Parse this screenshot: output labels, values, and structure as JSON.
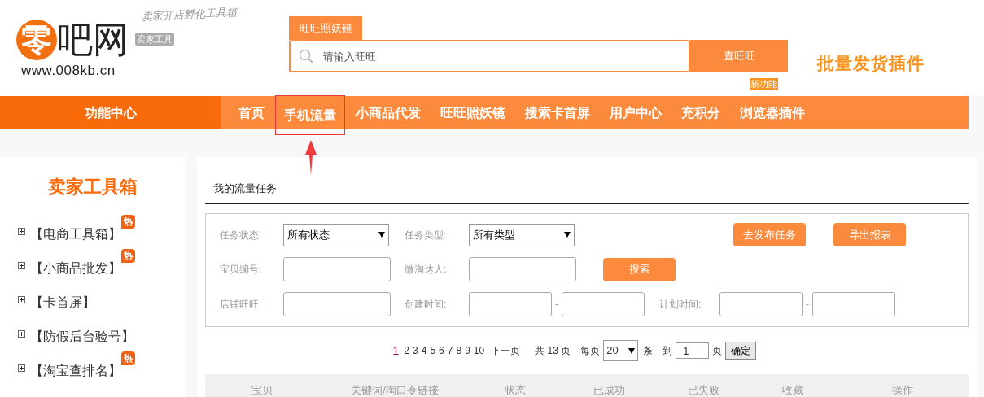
{
  "header": {
    "logo_mark": "零",
    "logo_text": "吧网",
    "url": "www.008kb.cn",
    "tagline": "卖家开店孵化工具箱",
    "badge": "卖家工具",
    "search": {
      "tab": "旺旺照妖镜",
      "placeholder": "请输入旺旺",
      "button": "查旺旺"
    },
    "promo": "批量发货插件"
  },
  "nav": {
    "title": "功能中心",
    "items": [
      {
        "label": "首页",
        "selected": false
      },
      {
        "label": "手机流量",
        "selected": true
      },
      {
        "label": "小商品代发",
        "selected": false
      },
      {
        "label": "旺旺照妖镜",
        "selected": false
      },
      {
        "label": "搜索卡首屏",
        "selected": false
      },
      {
        "label": "用户中心",
        "selected": false
      },
      {
        "label": "充积分",
        "selected": false
      },
      {
        "label": "浏览器插件",
        "selected": false,
        "badge": "新功能"
      }
    ]
  },
  "sidebar": {
    "title": "卖家工具箱",
    "items": [
      {
        "label": "【电商工具箱】",
        "hot": "热"
      },
      {
        "label": "【小商品批发】",
        "hot": "热"
      },
      {
        "label": "【卡首屏】"
      },
      {
        "label": "【防假后台验号】"
      },
      {
        "label": "【淘宝查排名】",
        "hot": "热"
      }
    ]
  },
  "main": {
    "title": "我的流量任务",
    "filters": {
      "status_label": "任务状态:",
      "status_value": "所有状态",
      "type_label": "任务类型:",
      "type_value": "所有类型",
      "publish_button": "去发布任务",
      "export_button": "导出报表",
      "item_label": "宝贝编号:",
      "talent_label": "微淘达人:",
      "search_button": "搜索",
      "shop_label": "店铺旺旺:",
      "created_label": "创建时间:",
      "created_dash": "-",
      "planned_label": "计划时间:",
      "planned_dash": "-"
    },
    "pagination": {
      "pages": [
        {
          "label": "1",
          "selected": true
        },
        {
          "label": "2",
          "selected": false
        },
        {
          "label": "3",
          "selected": false
        },
        {
          "label": "4",
          "selected": false
        },
        {
          "label": "5",
          "selected": false
        },
        {
          "label": "6",
          "selected": false
        },
        {
          "label": "7",
          "selected": false
        },
        {
          "label": "8",
          "selected": false
        },
        {
          "label": "9",
          "selected": false
        },
        {
          "label": "10",
          "selected": false
        }
      ],
      "next": "下一页",
      "total": "共 13 页",
      "per_page_label": "每页",
      "per_page_value": "20",
      "per_page_unit": "条",
      "goto_label": "到",
      "goto_value": "1",
      "goto_unit": "页",
      "confirm": "确定"
    },
    "table": {
      "columns": [
        "宝贝",
        "关键词/淘口令链接",
        "状态",
        "已成功",
        "已失败",
        "收藏",
        "操作"
      ]
    }
  }
}
